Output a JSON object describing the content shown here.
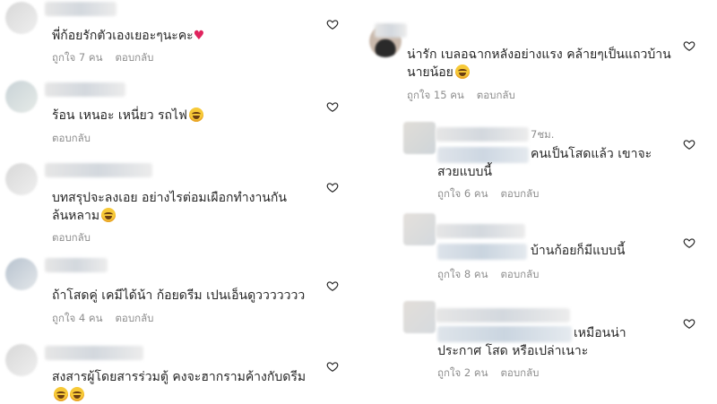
{
  "left": [
    {
      "text": "พี่ก้อยรักตัวเองเยอะๆนะคะ",
      "emoji": "red-heart",
      "likes": "ถูกใจ 7 คน",
      "reply": "ตอบกลับ"
    },
    {
      "text": "ร้อน เหนอะ เหนี่ยว รถไฟ",
      "emoji": "laughing-emoji",
      "likes": "",
      "reply": "ตอบกลับ"
    },
    {
      "text": "บทสรุปจะลงเอย อย่างไรต่อมเผือกทำงานกัน",
      "text2": "ล้นหลาม",
      "emoji": "laughing-emoji",
      "likes": "",
      "reply": "ตอบกลับ"
    },
    {
      "text": "ถ้าโสดคู่ เคมีได้น้า ก้อยดรีม เปนเอ็นดูววววววว",
      "likes": "ถูกใจ 4 คน",
      "reply": "ตอบกลับ"
    },
    {
      "text": "สงสารผู้โดยสารร่วมตู้ คงจะฮากรามค้างกับดรีม",
      "emoji": "laughing-emoji"
    }
  ],
  "right": [
    {
      "text": "น่ารัก เบลอฉากหลังอย่างแรง คล้ายๆเป็นแถวบ้าน",
      "text2": "นายน้อย",
      "emoji": "laughing-emoji",
      "likes": "ถูกใจ 15 คน",
      "reply": "ตอบกลับ"
    },
    {
      "partial": "7ชม.",
      "text": "คนเป็นโสดแล้ว เขาจะ",
      "text2": "สวยแบบนี้",
      "likes": "ถูกใจ 6 คน",
      "reply": "ตอบกลับ"
    },
    {
      "text": "บ้านก้อยก็มีแบบนี้",
      "likes": "ถูกใจ 8 คน",
      "reply": "ตอบกลับ"
    },
    {
      "text": "เหมือนน่า",
      "text2": "ประกาศ โสด หรือเปล่าเนาะ",
      "likes": "ถูกใจ 2 คน",
      "reply": "ตอบกลับ"
    }
  ],
  "colors": {
    "text": "#262626",
    "meta": "#8e8e8e",
    "heart_outline": "#262626"
  }
}
